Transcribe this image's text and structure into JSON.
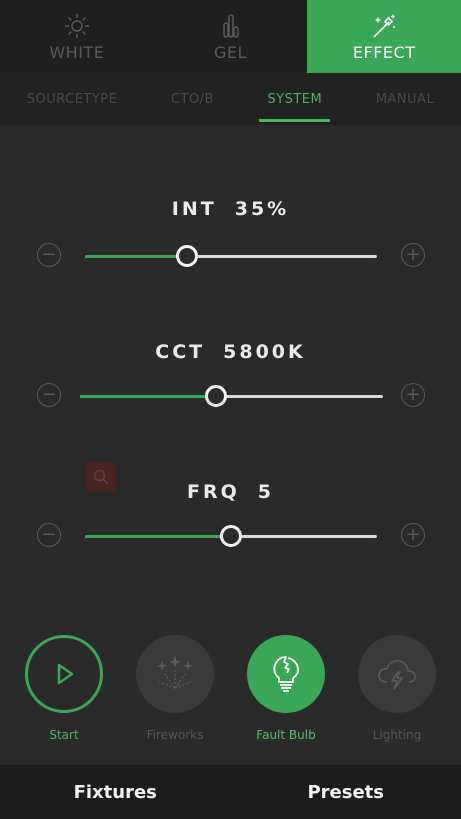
{
  "mode_tabs": [
    {
      "label": "WHITE",
      "icon": "sun-icon",
      "active": false
    },
    {
      "label": "GEL",
      "icon": "bars-icon",
      "active": false
    },
    {
      "label": "EFFECT",
      "icon": "magic-wand-icon",
      "active": true
    }
  ],
  "sub_tabs": [
    {
      "label": "SOURCETYPE",
      "active": false
    },
    {
      "label": "CTO/B",
      "active": false
    },
    {
      "label": "SYSTEM",
      "active": true
    },
    {
      "label": "MANUAL",
      "active": false
    }
  ],
  "sliders": {
    "int": {
      "name": "INT",
      "value_text": "35%",
      "fraction": 0.35
    },
    "cct": {
      "name": "CCT",
      "value_text": "5800K",
      "fraction": 0.45
    },
    "frq": {
      "name": "FRQ",
      "value_text": "5",
      "fraction": 0.5
    }
  },
  "effects": [
    {
      "label": "Start",
      "icon": "play-icon"
    },
    {
      "label": "Fireworks",
      "icon": "fireworks-icon"
    },
    {
      "label": "Fault Bulb",
      "icon": "broken-bulb-icon",
      "selected": true
    },
    {
      "label": "Lighting",
      "icon": "storm-cloud-icon"
    }
  ],
  "bottom_nav": {
    "fixtures": "Fixtures",
    "presets": "Presets"
  },
  "colors": {
    "accent": "#3aa657",
    "background": "#2a2a2a",
    "track": "#d8d8d8"
  }
}
